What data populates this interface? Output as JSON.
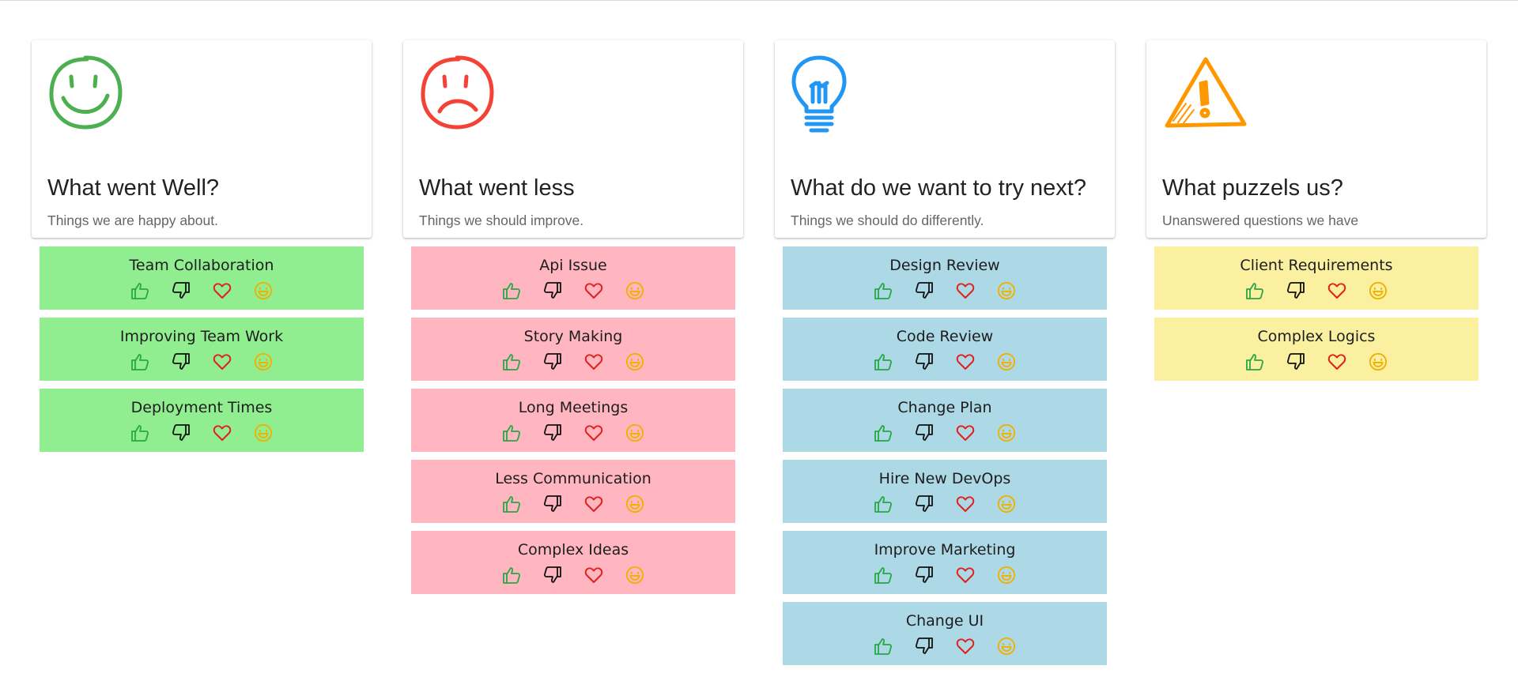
{
  "colors": {
    "well_card": "#90ee90",
    "less_card": "#ffb6c1",
    "next_card": "#add8e6",
    "puzzle_card": "#faf0a0",
    "thumb_up": "#28a745",
    "thumb_down": "#111111",
    "heart": "#e0201c",
    "smile": "#f0b000",
    "well_icon": "#4caf50",
    "less_icon": "#f44336",
    "next_icon": "#2196f3",
    "puzzle_icon": "#ff9800"
  },
  "columns": [
    {
      "icon": "smiley-face-icon",
      "title": "What went Well?",
      "subtitle": "Things we are happy about.",
      "items": [
        {
          "label": "Team Collaboration"
        },
        {
          "label": "Improving Team Work"
        },
        {
          "label": "Deployment Times"
        }
      ]
    },
    {
      "icon": "sad-face-icon",
      "title": "What went less",
      "subtitle": "Things we should improve.",
      "items": [
        {
          "label": "Api Issue"
        },
        {
          "label": "Story Making"
        },
        {
          "label": "Long Meetings"
        },
        {
          "label": "Less Communication"
        },
        {
          "label": "Complex Ideas"
        }
      ]
    },
    {
      "icon": "lightbulb-icon",
      "title": "What do we want to try next?",
      "subtitle": "Things we should do differently.",
      "items": [
        {
          "label": "Design Review"
        },
        {
          "label": "Code Review"
        },
        {
          "label": "Change Plan"
        },
        {
          "label": "Hire New DevOps"
        },
        {
          "label": "Improve Marketing"
        },
        {
          "label": "Change UI"
        }
      ]
    },
    {
      "icon": "warning-triangle-icon",
      "title": "What puzzels us?",
      "subtitle": "Unanswered questions we have",
      "items": [
        {
          "label": "Client Requirements"
        },
        {
          "label": "Complex Logics"
        }
      ]
    }
  ]
}
